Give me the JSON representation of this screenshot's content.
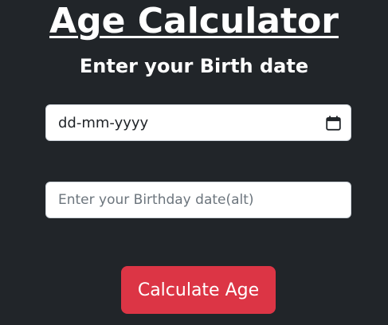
{
  "header": {
    "title": "Age Calculator",
    "subtitle": "Enter your Birth date"
  },
  "form": {
    "date_input": {
      "value_text": "dd-mm-yyyy",
      "icon": "calendar-icon"
    },
    "alt_input": {
      "value": "",
      "placeholder": "Enter your Birthday date(alt)"
    },
    "submit_label": "Calculate Age"
  },
  "colors": {
    "background": "#212529",
    "button": "#dc3545",
    "text": "#ffffff"
  }
}
